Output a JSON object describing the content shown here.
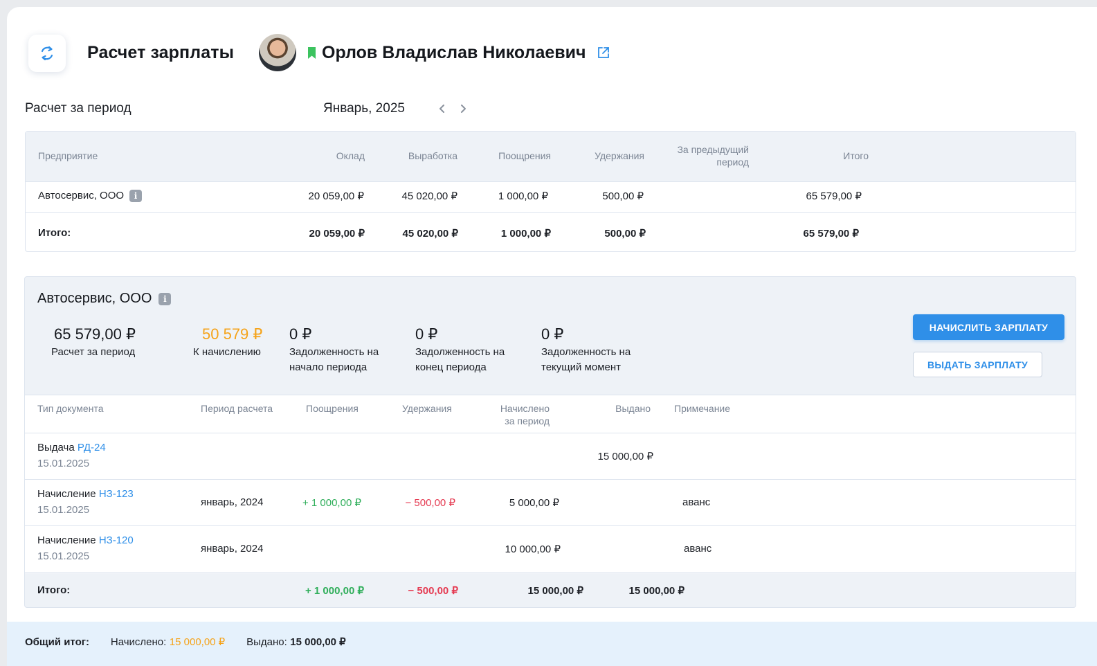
{
  "header": {
    "title": "Расчет зарплаты",
    "employee_name": "Орлов Владислав Николаевич",
    "refresh_icon": "refresh-icon",
    "external_link_icon": "external-link-icon",
    "bookmark_color": "#3cc35f"
  },
  "period": {
    "label": "Расчет за период",
    "value": "Январь, 2025"
  },
  "summary": {
    "columns": [
      "Предприятие",
      "Оклад",
      "Выработка",
      "Поощрения",
      "Удержания",
      "За предыдущий период",
      "Итого"
    ],
    "prev_period_line1": "За предыдущий",
    "prev_period_line2": "период",
    "rows": [
      {
        "company": "Автосервис, ООО",
        "salary": "20 059,00 ₽",
        "output": "45 020,00 ₽",
        "bonuses": "1 000,00 ₽",
        "deductions": "500,00 ₽",
        "prev_period": "",
        "total": "65 579,00 ₽"
      }
    ],
    "total_row": {
      "label": "Итого:",
      "salary": "20 059,00 ₽",
      "output": "45 020,00 ₽",
      "bonuses": "1 000,00 ₽",
      "deductions": "500,00 ₽",
      "prev_period": "",
      "total": "65 579,00 ₽"
    }
  },
  "company_block": {
    "title": "Автосервис, ООО",
    "metrics": [
      {
        "value": "65 579,00 ₽",
        "label": "Расчет за период"
      },
      {
        "value": "50 579 ₽",
        "label": "К начислению"
      },
      {
        "value": "0 ₽",
        "label_line1": "Задолженность на",
        "label_line2": "начало периода"
      },
      {
        "value": "0 ₽",
        "label_line1": "Задолженность на",
        "label_line2": "конец периода"
      },
      {
        "value": "0 ₽",
        "label_line1": "Задолженность на",
        "label_line2": "текущий момент"
      }
    ],
    "accrue_button": "НАЧИСЛИТЬ ЗАРПЛАТУ",
    "pay_button": "ВЫДАТЬ ЗАРПЛАТУ",
    "docs_columns": {
      "doc_type": "Тип документа",
      "calc_period": "Период расчета",
      "bonuses": "Поощрения",
      "deductions": "Удержания",
      "accrued_line1": "Начислено",
      "accrued_line2": "за период",
      "paid": "Выдано",
      "note": "Примечание"
    },
    "docs": [
      {
        "type": "Выдача",
        "number": "РД-24",
        "date": "15.01.2025",
        "period": "",
        "bonuses": "",
        "deductions": "",
        "accrued": "",
        "paid": "15 000,00 ₽",
        "note": ""
      },
      {
        "type": "Начисление",
        "number": "НЗ-123",
        "date": "15.01.2025",
        "period": "январь, 2024",
        "bonuses": "+ 1 000,00 ₽",
        "deductions": "− 500,00 ₽",
        "accrued": "5 000,00 ₽",
        "paid": "",
        "note": "аванс"
      },
      {
        "type": "Начисление",
        "number": "НЗ-120",
        "date": "15.01.2025",
        "period": "январь, 2024",
        "bonuses": "",
        "deductions": "",
        "accrued": "10 000,00 ₽",
        "paid": "",
        "note": "аванс"
      }
    ],
    "docs_total": {
      "label": "Итого:",
      "bonuses": "+ 1 000,00 ₽",
      "deductions": "− 500,00 ₽",
      "accrued": "15 000,00 ₽",
      "paid": "15 000,00 ₽"
    }
  },
  "footer": {
    "label": "Общий итог:",
    "accrued_label": "Начислено:",
    "accrued_value": "15 000,00 ₽",
    "paid_label": "Выдано:",
    "paid_value": "15 000,00 ₽"
  },
  "colors": {
    "accent": "#2f8fe8",
    "positive": "#2fae5a",
    "negative": "#e53b52",
    "highlight": "#f5a31a"
  }
}
